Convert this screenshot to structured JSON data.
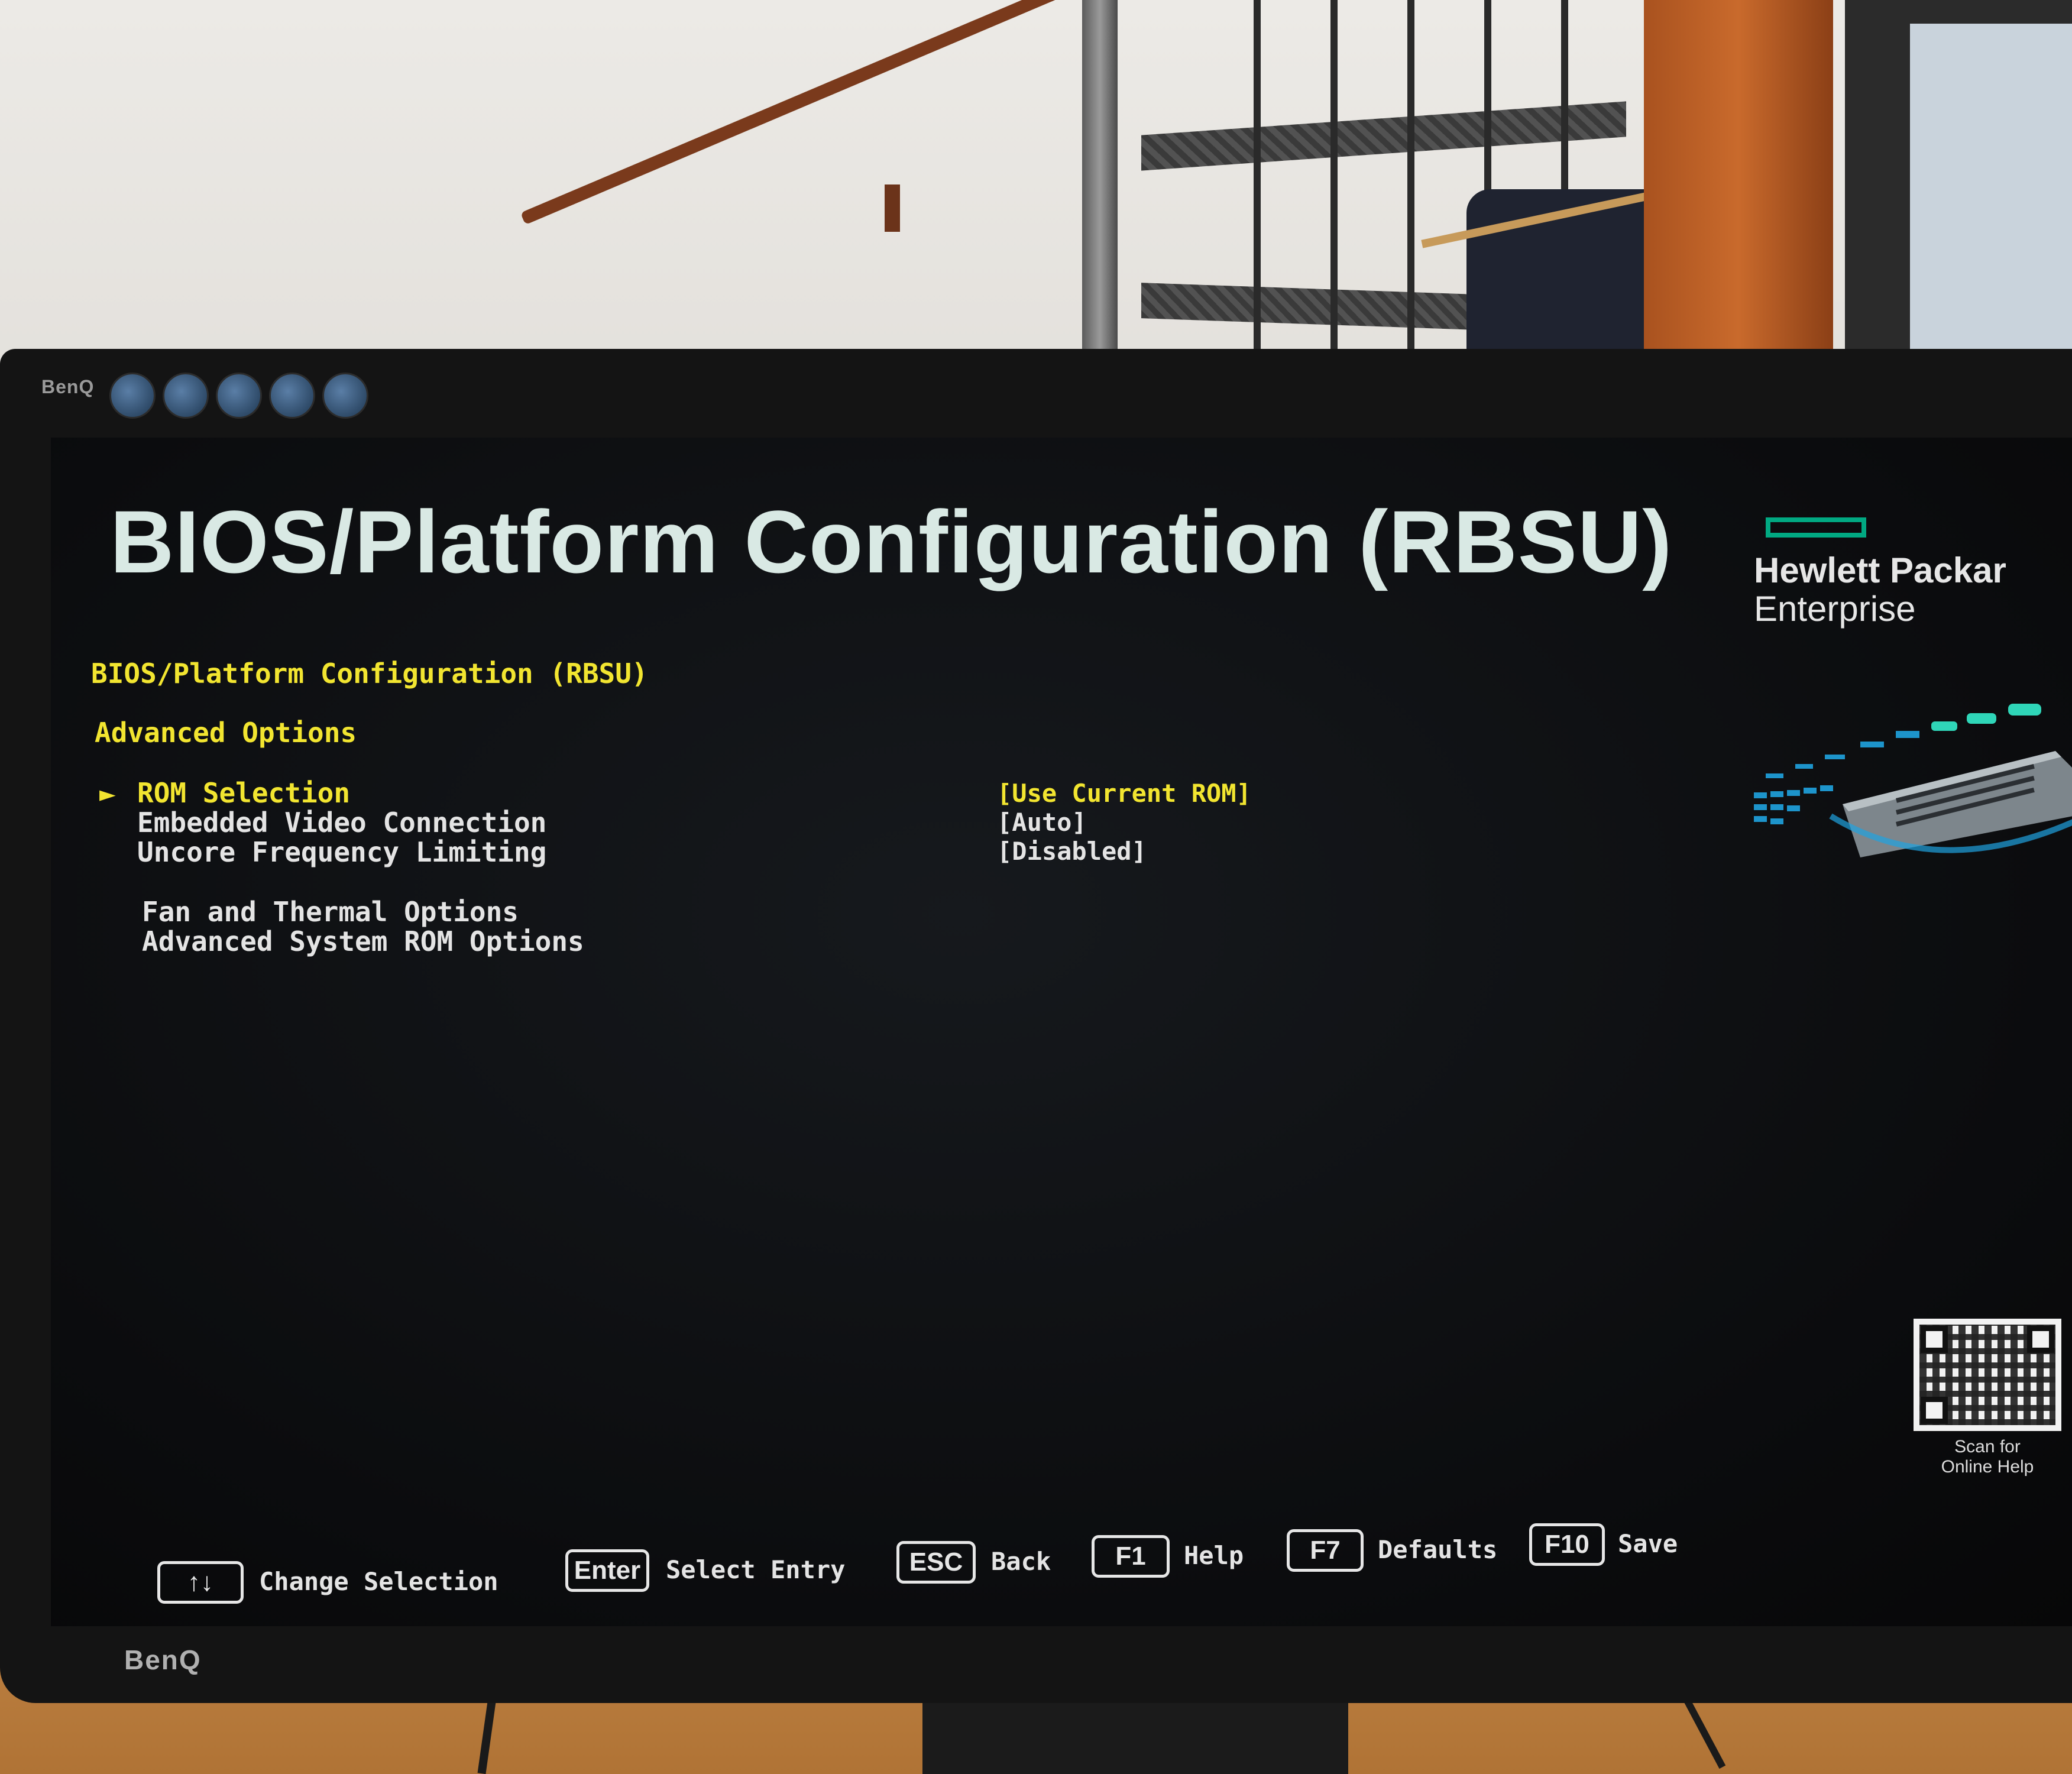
{
  "monitor": {
    "brand_top": "BenQ",
    "brand_bottom": "BenQ"
  },
  "header": {
    "title": "BIOS/Platform Configuration (RBSU)",
    "logo_line1": "Hewlett Packar",
    "logo_line2": "Enterprise"
  },
  "breadcrumb": {
    "path": "BIOS/Platform Configuration (RBSU)",
    "section": "Advanced Options"
  },
  "menu": {
    "cursor_glyph": "►",
    "items": [
      {
        "label": "ROM Selection",
        "value": "[Use Current ROM]",
        "selected": true
      },
      {
        "label": "Embedded Video Connection",
        "value": "[Auto]",
        "selected": false
      },
      {
        "label": "Uncore Frequency Limiting",
        "value": "[Disabled]",
        "selected": false
      }
    ],
    "submenus": [
      {
        "label": "Fan and Thermal Options"
      },
      {
        "label": "Advanced System ROM Options"
      }
    ]
  },
  "help": {
    "qr_caption_line1": "Scan for",
    "qr_caption_line2": "Online Help"
  },
  "footer": {
    "keys": [
      {
        "key": "↑↓",
        "label": "Change Selection"
      },
      {
        "key": "Enter",
        "label": "Select Entry"
      },
      {
        "key": "ESC",
        "label": "Back"
      },
      {
        "key": "F1",
        "label": "Help"
      },
      {
        "key": "F7",
        "label": "Defaults"
      },
      {
        "key": "F10",
        "label": "Save"
      }
    ]
  },
  "colors": {
    "highlight": "#f2e530",
    "text": "#e4e4e4",
    "hpe_green": "#01a982",
    "screen_bg": "#0b0c0e"
  }
}
